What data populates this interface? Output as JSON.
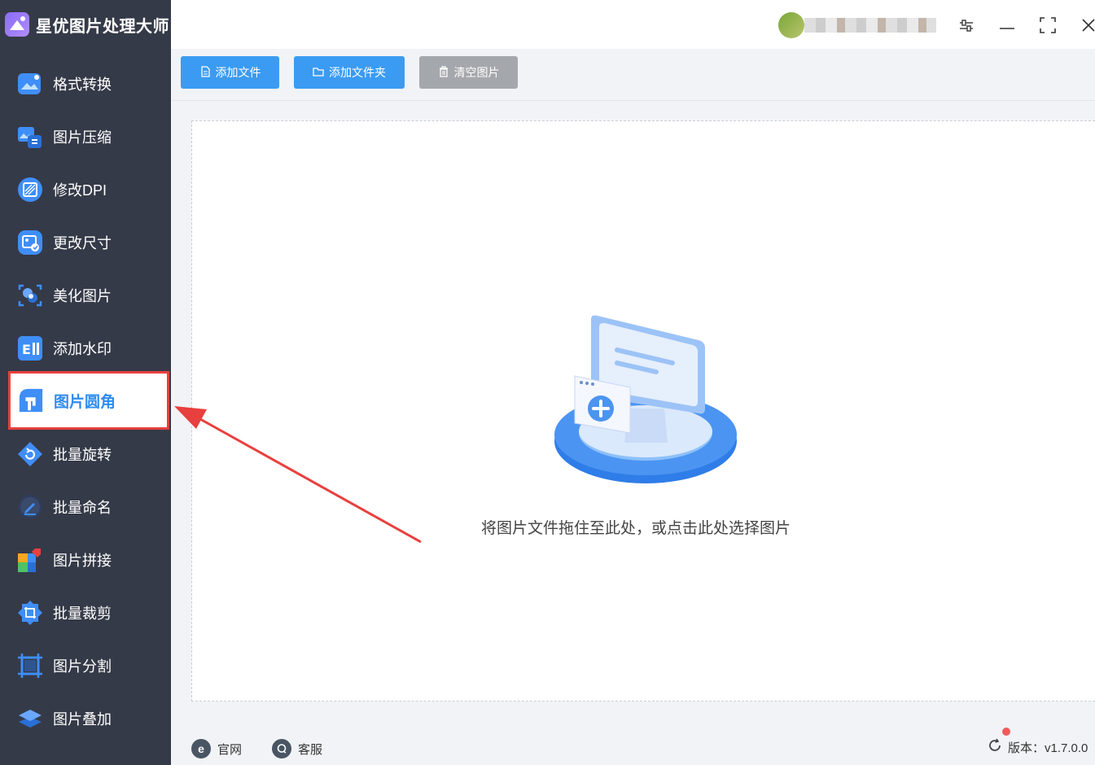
{
  "app": {
    "name": "星优图片处理大师"
  },
  "sidebar": {
    "items": [
      {
        "label": "格式转换",
        "icon": "format-convert-icon"
      },
      {
        "label": "图片压缩",
        "icon": "image-compress-icon"
      },
      {
        "label": "修改DPI",
        "icon": "dpi-icon"
      },
      {
        "label": "更改尺寸",
        "icon": "resize-icon"
      },
      {
        "label": "美化图片",
        "icon": "beautify-icon"
      },
      {
        "label": "添加水印",
        "icon": "watermark-icon"
      },
      {
        "label": "图片圆角",
        "icon": "rounded-corner-icon",
        "active": true
      },
      {
        "label": "批量旋转",
        "icon": "rotate-icon"
      },
      {
        "label": "批量命名",
        "icon": "rename-icon"
      },
      {
        "label": "图片拼接",
        "icon": "stitch-icon"
      },
      {
        "label": "批量裁剪",
        "icon": "crop-icon"
      },
      {
        "label": "图片分割",
        "icon": "split-icon"
      },
      {
        "label": "图片叠加",
        "icon": "overlay-icon"
      }
    ]
  },
  "toolbar": {
    "add_file": "添加文件",
    "add_folder": "添加文件夹",
    "clear": "清空图片"
  },
  "dropzone": {
    "text": "将图片文件拖住至此处，或点击此处选择图片"
  },
  "footer": {
    "website": "官网",
    "support": "客服",
    "version": "版本：v1.7.0.0"
  },
  "colors": {
    "sidebar_bg": "#353a48",
    "accent": "#3b9bf2",
    "highlight_red": "#e8403e"
  }
}
